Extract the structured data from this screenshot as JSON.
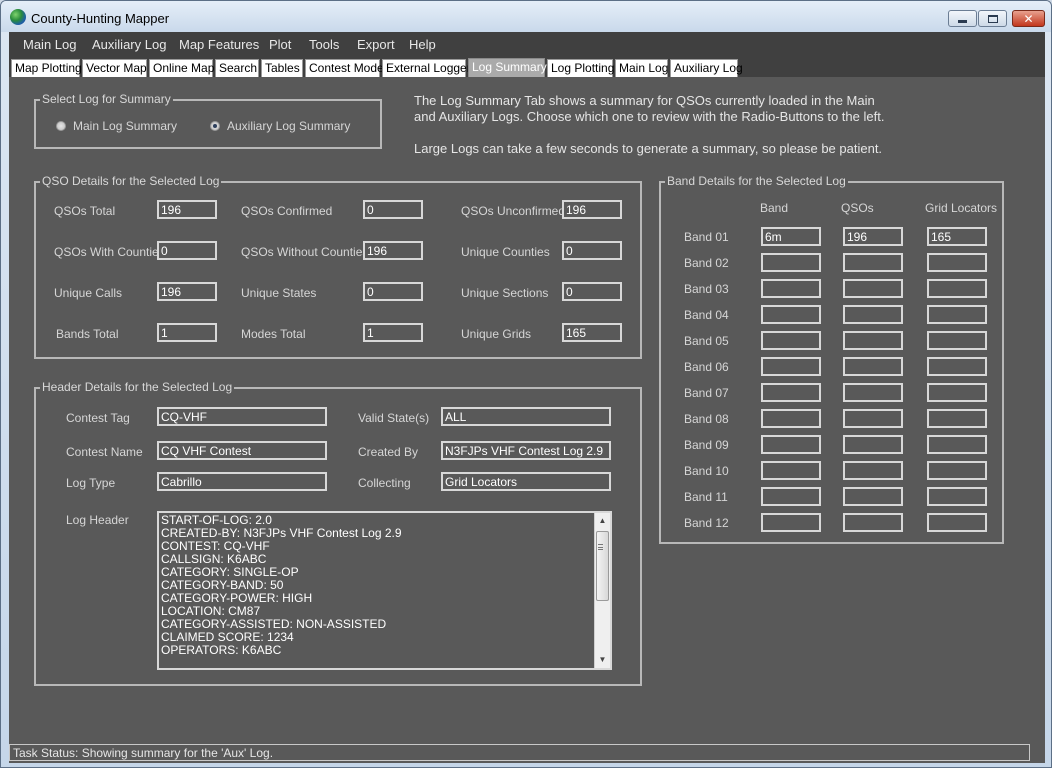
{
  "window": {
    "title": "County-Hunting Mapper"
  },
  "menu": [
    "Main Log",
    "Auxiliary Log",
    "Map Features",
    "Plot",
    "Tools",
    "Export",
    "Help"
  ],
  "tabs": [
    {
      "label": "Map Plotting",
      "active": false
    },
    {
      "label": "Vector Map",
      "active": false
    },
    {
      "label": "Online Map",
      "active": false
    },
    {
      "label": "Search",
      "active": false
    },
    {
      "label": "Tables",
      "active": false
    },
    {
      "label": "Contest Mode",
      "active": false
    },
    {
      "label": "External Logger",
      "active": false
    },
    {
      "label": "Log Summary",
      "active": true
    },
    {
      "label": "Log Plotting",
      "active": false
    },
    {
      "label": "Main Log",
      "active": false
    },
    {
      "label": "Auxiliary Log",
      "active": false
    }
  ],
  "select_log": {
    "caption": "Select Log for Summary",
    "main_label": "Main Log Summary",
    "aux_label": "Auxiliary Log Summary",
    "selected": "aux"
  },
  "info": {
    "line1": "The Log Summary Tab shows a summary for QSOs currently loaded in the Main",
    "line2": "and Auxiliary Logs. Choose which one to review with the Radio-Buttons to the left.",
    "line3": "Large Logs can take a few seconds to generate a summary, so please be patient."
  },
  "qso": {
    "caption": "QSO Details for the Selected Log",
    "fields": [
      {
        "label": "QSOs Total",
        "value": "196"
      },
      {
        "label": "QSOs Confirmed",
        "value": "0"
      },
      {
        "label": "QSOs Unconfirmed",
        "value": "196"
      },
      {
        "label": "QSOs With Counties",
        "value": "0"
      },
      {
        "label": "QSOs Without Counties",
        "value": "196"
      },
      {
        "label": "Unique Counties",
        "value": "0"
      },
      {
        "label": "Unique Calls",
        "value": "196"
      },
      {
        "label": "Unique States",
        "value": "0"
      },
      {
        "label": "Unique Sections",
        "value": "0"
      },
      {
        "label": "Bands Total",
        "value": "1"
      },
      {
        "label": "Modes Total",
        "value": "1"
      },
      {
        "label": "Unique Grids",
        "value": "165"
      }
    ]
  },
  "header": {
    "caption": "Header Details for the Selected Log",
    "contest_tag_label": "Contest Tag",
    "contest_tag": "CQ-VHF",
    "valid_states_label": "Valid State(s)",
    "valid_states": "ALL",
    "contest_name_label": "Contest Name",
    "contest_name": "CQ VHF Contest",
    "created_by_label": "Created By",
    "created_by": "N3FJPs VHF Contest Log 2.9",
    "log_type_label": "Log Type",
    "log_type": "Cabrillo",
    "collecting_label": "Collecting",
    "collecting": "Grid Locators",
    "log_header_label": "Log Header",
    "log_header_lines": [
      "START-OF-LOG: 2.0",
      "CREATED-BY: N3FJPs VHF Contest Log 2.9",
      "CONTEST: CQ-VHF",
      "CALLSIGN: K6ABC",
      "CATEGORY: SINGLE-OP",
      "CATEGORY-BAND: 50",
      "CATEGORY-POWER: HIGH",
      "LOCATION: CM87",
      "CATEGORY-ASSISTED: NON-ASSISTED",
      "CLAIMED SCORE: 1234",
      "OPERATORS: K6ABC"
    ]
  },
  "bands": {
    "caption": "Band Details for the Selected Log",
    "col_band": "Band",
    "col_qsos": "QSOs",
    "col_grids": "Grid Locators",
    "rows": [
      {
        "label": "Band 01",
        "band": "6m",
        "qsos": "196",
        "grids": "165"
      },
      {
        "label": "Band 02",
        "band": "",
        "qsos": "",
        "grids": ""
      },
      {
        "label": "Band 03",
        "band": "",
        "qsos": "",
        "grids": ""
      },
      {
        "label": "Band 04",
        "band": "",
        "qsos": "",
        "grids": ""
      },
      {
        "label": "Band 05",
        "band": "",
        "qsos": "",
        "grids": ""
      },
      {
        "label": "Band 06",
        "band": "",
        "qsos": "",
        "grids": ""
      },
      {
        "label": "Band 07",
        "band": "",
        "qsos": "",
        "grids": ""
      },
      {
        "label": "Band 08",
        "band": "",
        "qsos": "",
        "grids": ""
      },
      {
        "label": "Band 09",
        "band": "",
        "qsos": "",
        "grids": ""
      },
      {
        "label": "Band 10",
        "band": "",
        "qsos": "",
        "grids": ""
      },
      {
        "label": "Band 11",
        "band": "",
        "qsos": "",
        "grids": ""
      },
      {
        "label": "Band 12",
        "band": "",
        "qsos": "",
        "grids": ""
      }
    ]
  },
  "status": {
    "text": "Task Status: Showing summary for the 'Aux' Log."
  }
}
